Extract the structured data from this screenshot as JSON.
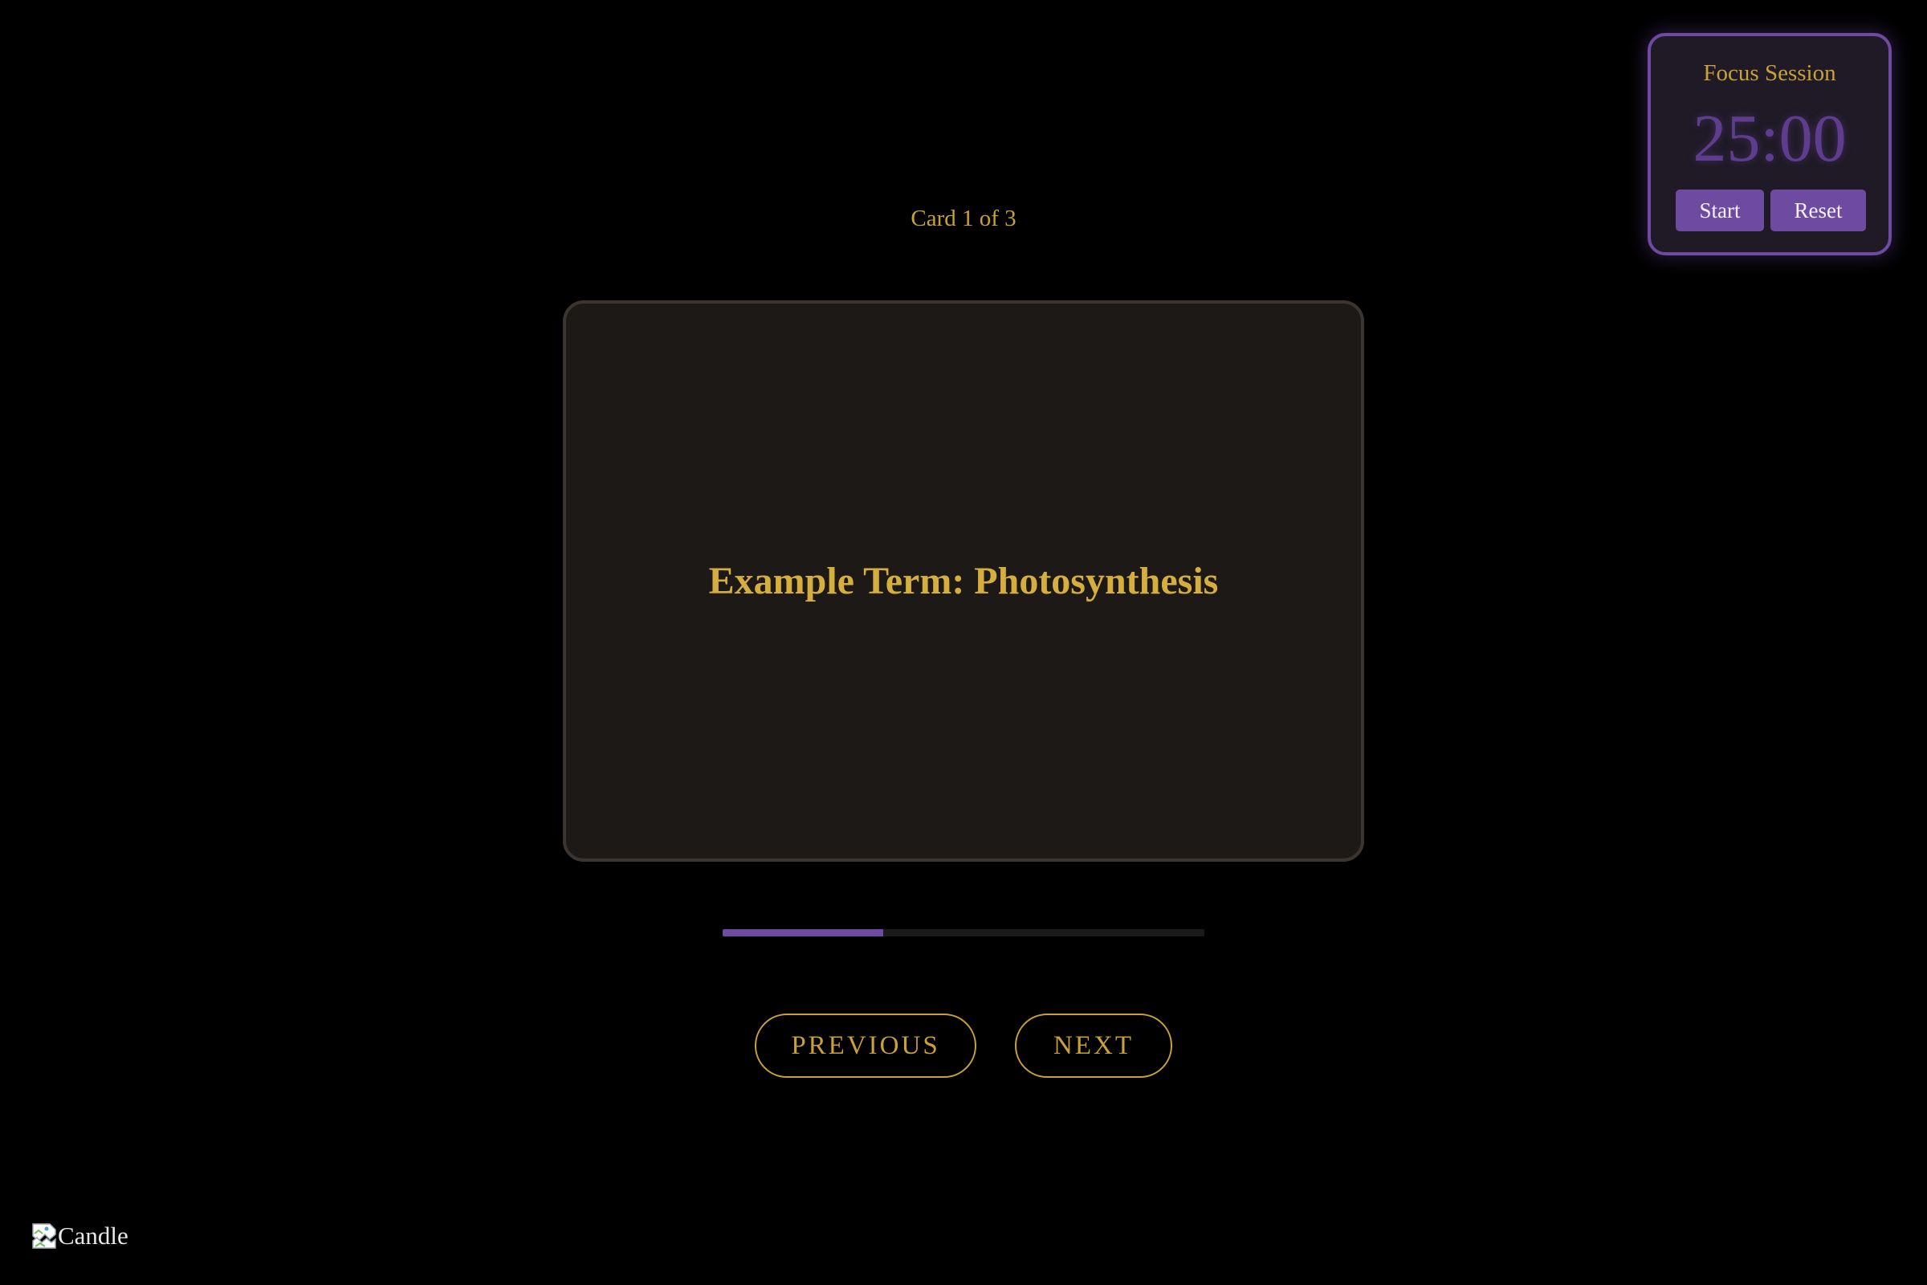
{
  "focus_session": {
    "title": "Focus Session",
    "time": "25:00",
    "start_label": "Start",
    "reset_label": "Reset"
  },
  "flashcards": {
    "counter": "Card 1 of 3",
    "current_term": "Example Term: Photosynthesis",
    "progress_fraction": 0.333
  },
  "navigation": {
    "previous_label": "PREVIOUS",
    "next_label": "NEXT"
  },
  "candle_image": {
    "alt_text": "Candle",
    "icon": "broken-image-icon"
  },
  "colors": {
    "background": "#000000",
    "accent_gold": "#c9a135",
    "accent_purple": "#6e4aa0",
    "card_surface": "#1c1916"
  }
}
